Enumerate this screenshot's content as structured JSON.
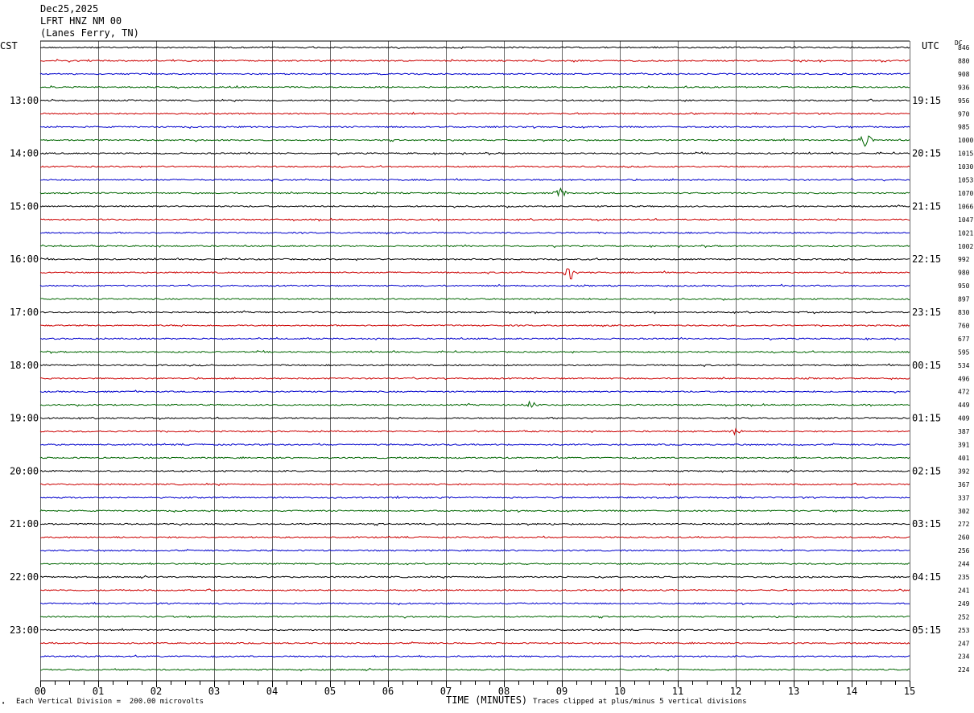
{
  "header": {
    "date": "Dec25,2025",
    "station": "LFRT HNZ NM 00",
    "location": "(Lanes Ferry, TN)"
  },
  "left_axis_label": "CST",
  "right_axis_label": "UTC",
  "dc_label": "DC",
  "footer": {
    "scale_note": "Each Vertical Division =  200.00 microvolts",
    "x_title": "TIME (MINUTES)",
    "clip_note": "Traces clipped at plus/minus 5 vertical divisions",
    "corner_mark": "•"
  },
  "colors": {
    "trace_cycle": [
      "#000000",
      "#cc0000",
      "#0000cc",
      "#006600"
    ],
    "grid": "#000000"
  },
  "chart_data": {
    "type": "line",
    "title": "",
    "xlabel": "TIME (MINUTES)",
    "ylabel": "",
    "xlim": [
      0,
      15
    ],
    "x_ticks": [
      "00",
      "01",
      "02",
      "03",
      "04",
      "05",
      "06",
      "07",
      "08",
      "09",
      "10",
      "11",
      "12",
      "13",
      "14",
      "15"
    ],
    "minor_ticks_per_minute": 4,
    "line_minutes": 15,
    "left_time_labels": [
      "13:00",
      "14:00",
      "15:00",
      "16:00",
      "17:00",
      "18:00",
      "19:00",
      "20:00",
      "21:00",
      "22:00",
      "23:00"
    ],
    "right_time_labels": [
      "19:15",
      "20:15",
      "21:15",
      "22:15",
      "23:15",
      "00:15",
      "01:15",
      "02:15",
      "03:15",
      "04:15",
      "05:15"
    ],
    "hour_label_first_line": 4,
    "dc_values": [
      846,
      880,
      908,
      936,
      956,
      970,
      985,
      1000,
      1015,
      1030,
      1053,
      1070,
      1066,
      1047,
      1021,
      1002,
      992,
      980,
      950,
      897,
      830,
      760,
      677,
      595,
      534,
      496,
      472,
      449,
      409,
      387,
      391,
      401,
      392,
      367,
      337,
      302,
      272,
      260,
      256,
      244,
      235,
      241,
      249,
      252,
      253,
      247,
      234,
      224
    ],
    "events": [
      {
        "line": 7,
        "minute": 14.25,
        "amp": 1.0
      },
      {
        "line": 11,
        "minute": 8.95,
        "amp": 0.9
      },
      {
        "line": 17,
        "minute": 9.15,
        "amp": 1.1
      },
      {
        "line": 27,
        "minute": 8.45,
        "amp": 0.5
      },
      {
        "line": 29,
        "minute": 12.0,
        "amp": 0.5
      }
    ]
  }
}
